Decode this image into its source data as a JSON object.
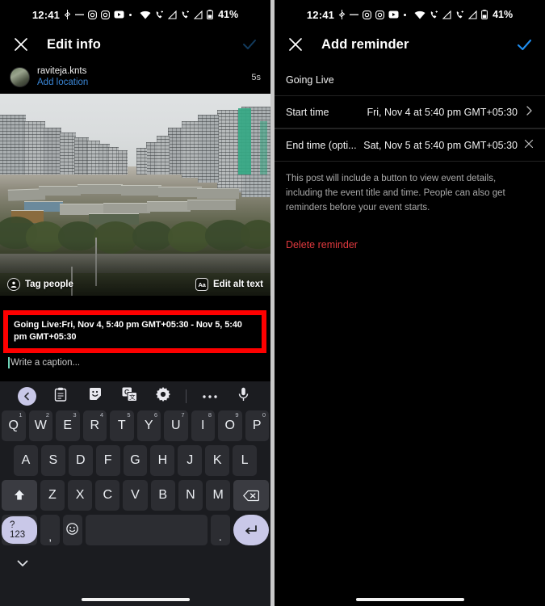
{
  "status_bar": {
    "time": "12:41",
    "icons": [
      "bluetooth-headset-icon",
      "dnd-icon",
      "instagram-icon",
      "instagram-icon",
      "youtube-icon",
      "dot-icon",
      "wifi-icon",
      "call-icon",
      "signal-icon",
      "call-icon",
      "signal-icon",
      "battery-icon"
    ],
    "battery": "41%"
  },
  "left_panel": {
    "header": {
      "close_label": "✕",
      "title": "Edit info",
      "confirm_label": "✓"
    },
    "user": {
      "username": "raviteja.knts",
      "add_location": "Add location",
      "duration": "5s"
    },
    "photo": {
      "tag_people": "Tag people",
      "tag_icon_glyph": "•",
      "edit_alt_text": "Edit alt text",
      "alt_icon_glyph": "Aa"
    },
    "highlight": {
      "color": "#fe0000",
      "text": "Going Live:Fri, Nov 4, 5:40 pm GMT+05:30 - Nov 5, 5:40 pm GMT+05:30"
    },
    "caption": {
      "placeholder": "Write a caption..."
    },
    "keyboard": {
      "toolbar": [
        {
          "name": "back-chevron-icon",
          "glyph": "‹"
        },
        {
          "name": "clipboard-icon",
          "glyph": "📋"
        },
        {
          "name": "sticker-icon",
          "glyph": "☺"
        },
        {
          "name": "translate-icon",
          "glyph": "G"
        },
        {
          "name": "settings-gear-icon",
          "glyph": "⚙"
        },
        {
          "name": "divider",
          "glyph": ""
        },
        {
          "name": "more-options-icon",
          "glyph": "•••"
        },
        {
          "name": "microphone-icon",
          "glyph": "🎤"
        }
      ],
      "row1": [
        {
          "key": "Q",
          "num": "1"
        },
        {
          "key": "W",
          "num": "2"
        },
        {
          "key": "E",
          "num": "3"
        },
        {
          "key": "R",
          "num": "4"
        },
        {
          "key": "T",
          "num": "5"
        },
        {
          "key": "Y",
          "num": "6"
        },
        {
          "key": "U",
          "num": "7"
        },
        {
          "key": "I",
          "num": "8"
        },
        {
          "key": "O",
          "num": "9"
        },
        {
          "key": "P",
          "num": "0"
        }
      ],
      "row2": [
        "A",
        "S",
        "D",
        "F",
        "G",
        "H",
        "J",
        "K",
        "L"
      ],
      "row3": [
        "Z",
        "X",
        "C",
        "V",
        "B",
        "N",
        "M"
      ],
      "shift_label": "⬆",
      "backspace_label": "⌫",
      "symbols_label": "?123",
      "comma_label": ",",
      "emoji_label": "☺",
      "space_label": "",
      "period_label": ".",
      "enter_label": "↵",
      "hide_keyboard_label": "˅"
    }
  },
  "right_panel": {
    "header": {
      "close_label": "✕",
      "title": "Add reminder",
      "confirm_label": "✓",
      "confirm_color": "#1f8ef1"
    },
    "event_title": "Going Live",
    "rows": [
      {
        "label": "Start time",
        "value": "Fri, Nov 4 at 5:40 pm GMT+05:30",
        "action_icon": "chevron-right-icon",
        "action_glyph": "›"
      },
      {
        "label": "End time (opti...",
        "value": "Sat, Nov 5 at 5:40 pm GMT+05:30",
        "action_icon": "close-icon",
        "action_glyph": "✕"
      }
    ],
    "description": "This post will include a button to view event details, including the event title and time. People can also get reminders before your event starts.",
    "delete_label": "Delete reminder",
    "delete_color": "#e0393e"
  }
}
